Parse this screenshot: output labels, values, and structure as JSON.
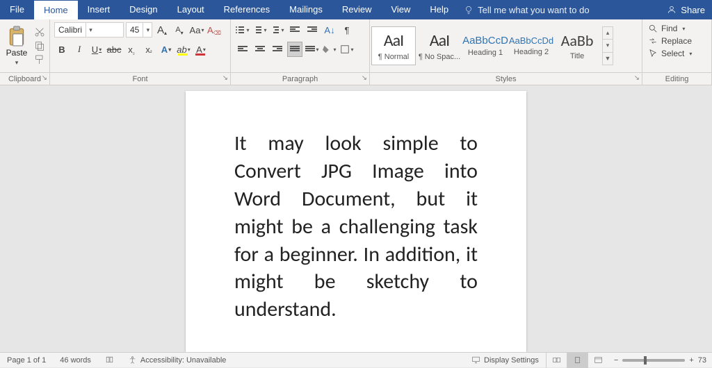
{
  "titlebar": {
    "tabs": [
      "File",
      "Home",
      "Insert",
      "Design",
      "Layout",
      "References",
      "Mailings",
      "Review",
      "View",
      "Help"
    ],
    "active_tab": 1,
    "tellme": "Tell me what you want to do",
    "share": "Share"
  },
  "ribbon": {
    "clipboard": {
      "label": "Clipboard",
      "paste": "Paste"
    },
    "font": {
      "label": "Font",
      "name": "Calibri",
      "size": "45",
      "buttons": {
        "bold": "B",
        "italic": "I",
        "underline": "U",
        "strike": "abc",
        "sub": "x",
        "sup": "x",
        "caps": "Aa",
        "clear": "A",
        "textfx": "A",
        "highlight": "ab",
        "color": "A",
        "growA": "A",
        "shrinkA": "A"
      }
    },
    "paragraph": {
      "label": "Paragraph"
    },
    "styles": {
      "label": "Styles",
      "items": [
        {
          "sample": "AaI",
          "name": "¶ Normal",
          "cls": "big"
        },
        {
          "sample": "AaI",
          "name": "¶ No Spac...",
          "cls": "big"
        },
        {
          "sample": "AaBbCcD",
          "name": "Heading 1",
          "cls": "h"
        },
        {
          "sample": "AaBbCcDd",
          "name": "Heading 2",
          "cls": "h"
        },
        {
          "sample": "AaBb",
          "name": "Title",
          "cls": "title"
        }
      ]
    },
    "editing": {
      "label": "Editing",
      "find": "Find",
      "replace": "Replace",
      "select": "Select"
    }
  },
  "document": {
    "body": "It may look simple to Convert JPG Image into Word Document, but it might be a challenging task for a beginner. In addition, it might be sketchy to understand."
  },
  "status": {
    "page": "Page 1 of 1",
    "words": "46 words",
    "a11y": "Accessibility: Unavailable",
    "display": "Display Settings",
    "zoom": "73"
  }
}
